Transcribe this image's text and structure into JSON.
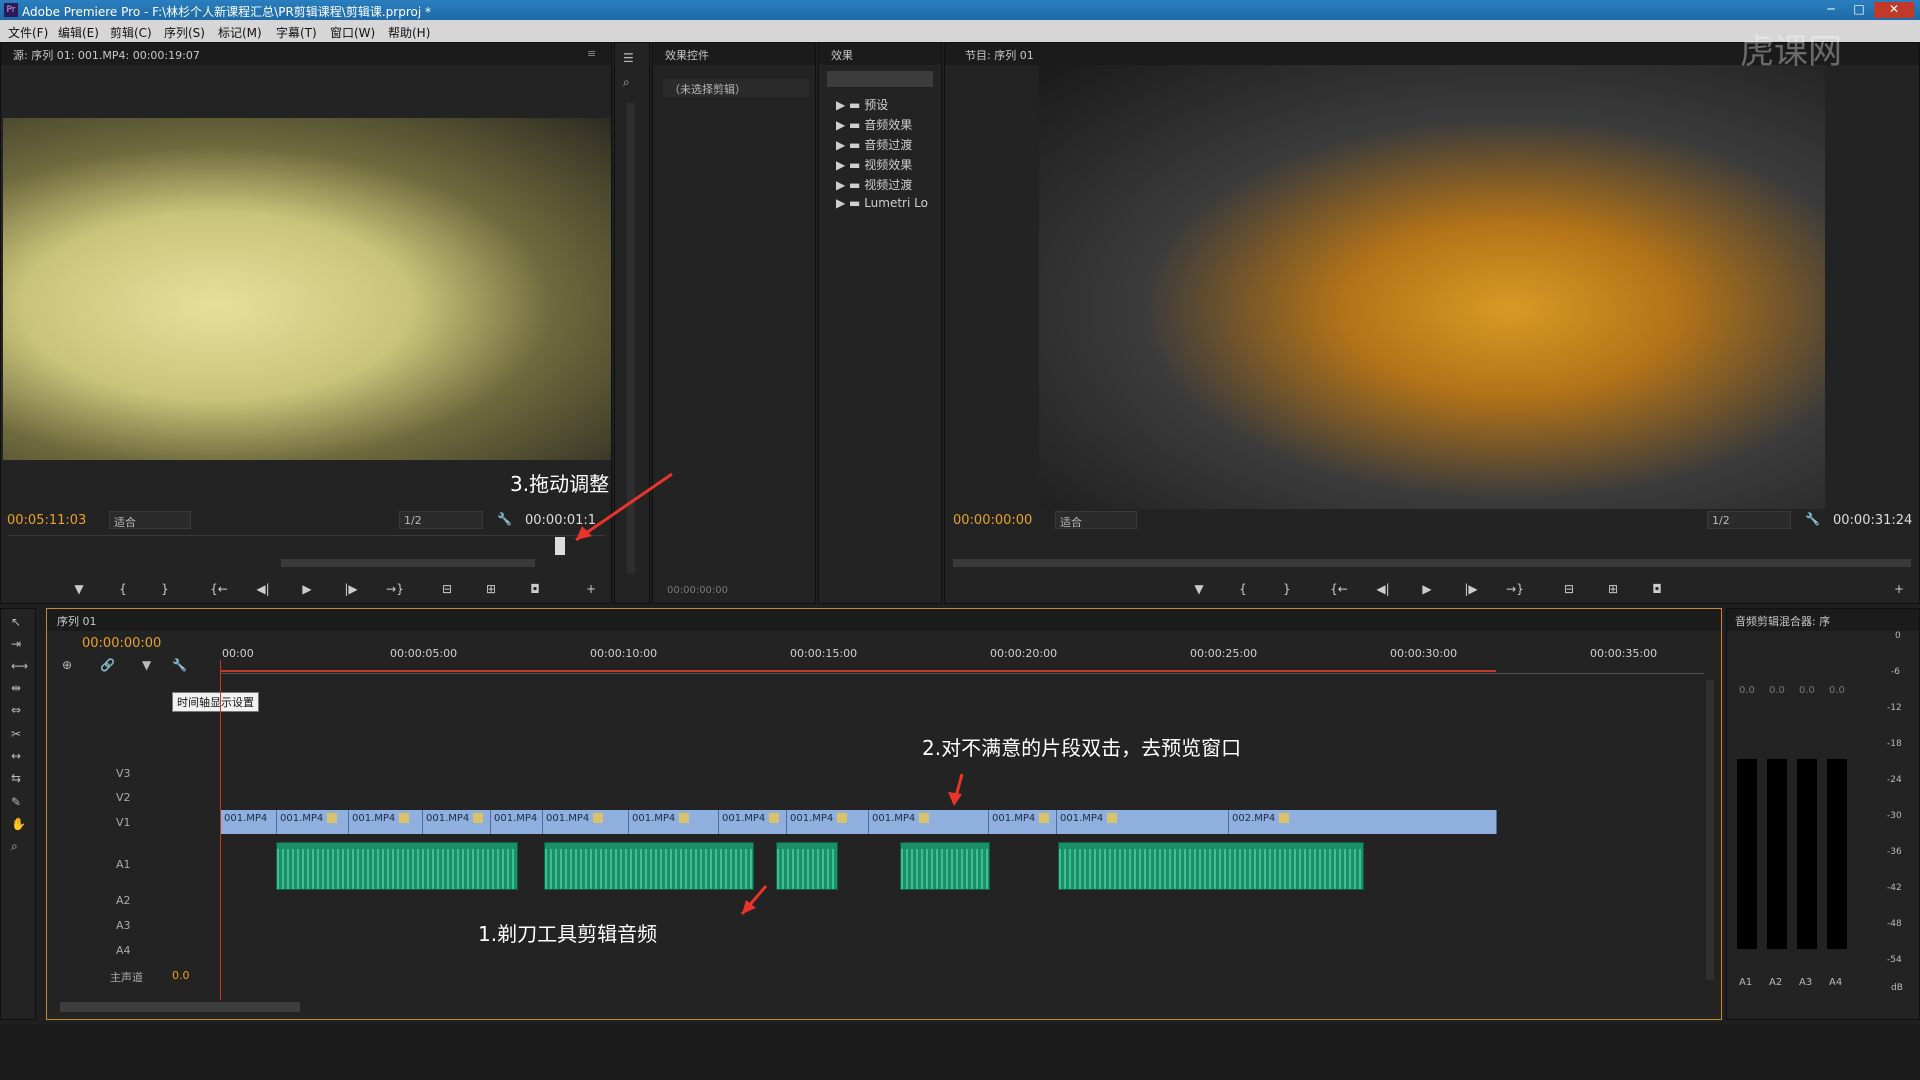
{
  "window": {
    "title": "Adobe Premiere Pro - F:\\林杉个人新课程汇总\\PR剪辑课程\\剪辑课.prproj *"
  },
  "menu": [
    "文件(F)",
    "编辑(E)",
    "剪辑(C)",
    "序列(S)",
    "标记(M)",
    "字幕(T)",
    "窗口(W)",
    "帮助(H)"
  ],
  "source": {
    "tab": "源: 序列 01: 001.MP4: 00:00:19:07",
    "timecode": "00:05:11:03",
    "fit": "适合",
    "res": "1/2",
    "duration": "00:00:01:1"
  },
  "effect_controls": {
    "tab": "效果控件",
    "no_clip": "（未选择剪辑）",
    "time": "00:00:00:00"
  },
  "effects": {
    "tab": "效果",
    "folders": [
      "预设",
      "音频效果",
      "音频过渡",
      "视频效果",
      "视频过渡",
      "Lumetri Lo"
    ]
  },
  "program": {
    "tab": "节目: 序列 01",
    "timecode": "00:00:00:00",
    "fit": "适合",
    "res": "1/2",
    "duration": "00:00:31:24"
  },
  "timeline": {
    "tab": "序列 01",
    "timecode": "00:00:00:00",
    "ruler": [
      "00:00",
      "00:00:05:00",
      "00:00:10:00",
      "00:00:15:00",
      "00:00:20:00",
      "00:00:25:00",
      "00:00:30:00",
      "00:00:35:00"
    ],
    "tooltip": "时间轴显示设置",
    "tracks": [
      "V3",
      "V2",
      "V1",
      "A1",
      "A2",
      "A3",
      "A4"
    ],
    "master": "主声道",
    "master_val": "0.0",
    "clips_v1": [
      "001.MP4",
      "001.MP4",
      "001.MP4",
      "001.MP4",
      "001.MP4",
      "001.MP4",
      "001.MP4",
      "001.MP4",
      "001.MP4",
      "001.MP4",
      "001.MP4",
      "001.MP4",
      "002.MP4"
    ]
  },
  "mixer": {
    "tab": "音频剪辑混合器: 序",
    "channels": [
      "A1",
      "A2",
      "A3",
      "A4"
    ],
    "values": [
      "0.0",
      "0.0",
      "0.0",
      "0.0"
    ],
    "db": [
      "0",
      "-6",
      "-12",
      "-18",
      "-24",
      "-30",
      "-36",
      "-42",
      "-48",
      "-54",
      "dB"
    ]
  },
  "annotations": {
    "a1": "1.剃刀工具剪辑音频",
    "a2": "2.对不满意的片段双击，去预览窗口",
    "a3": "3.拖动调整"
  },
  "watermark": "虎课网"
}
